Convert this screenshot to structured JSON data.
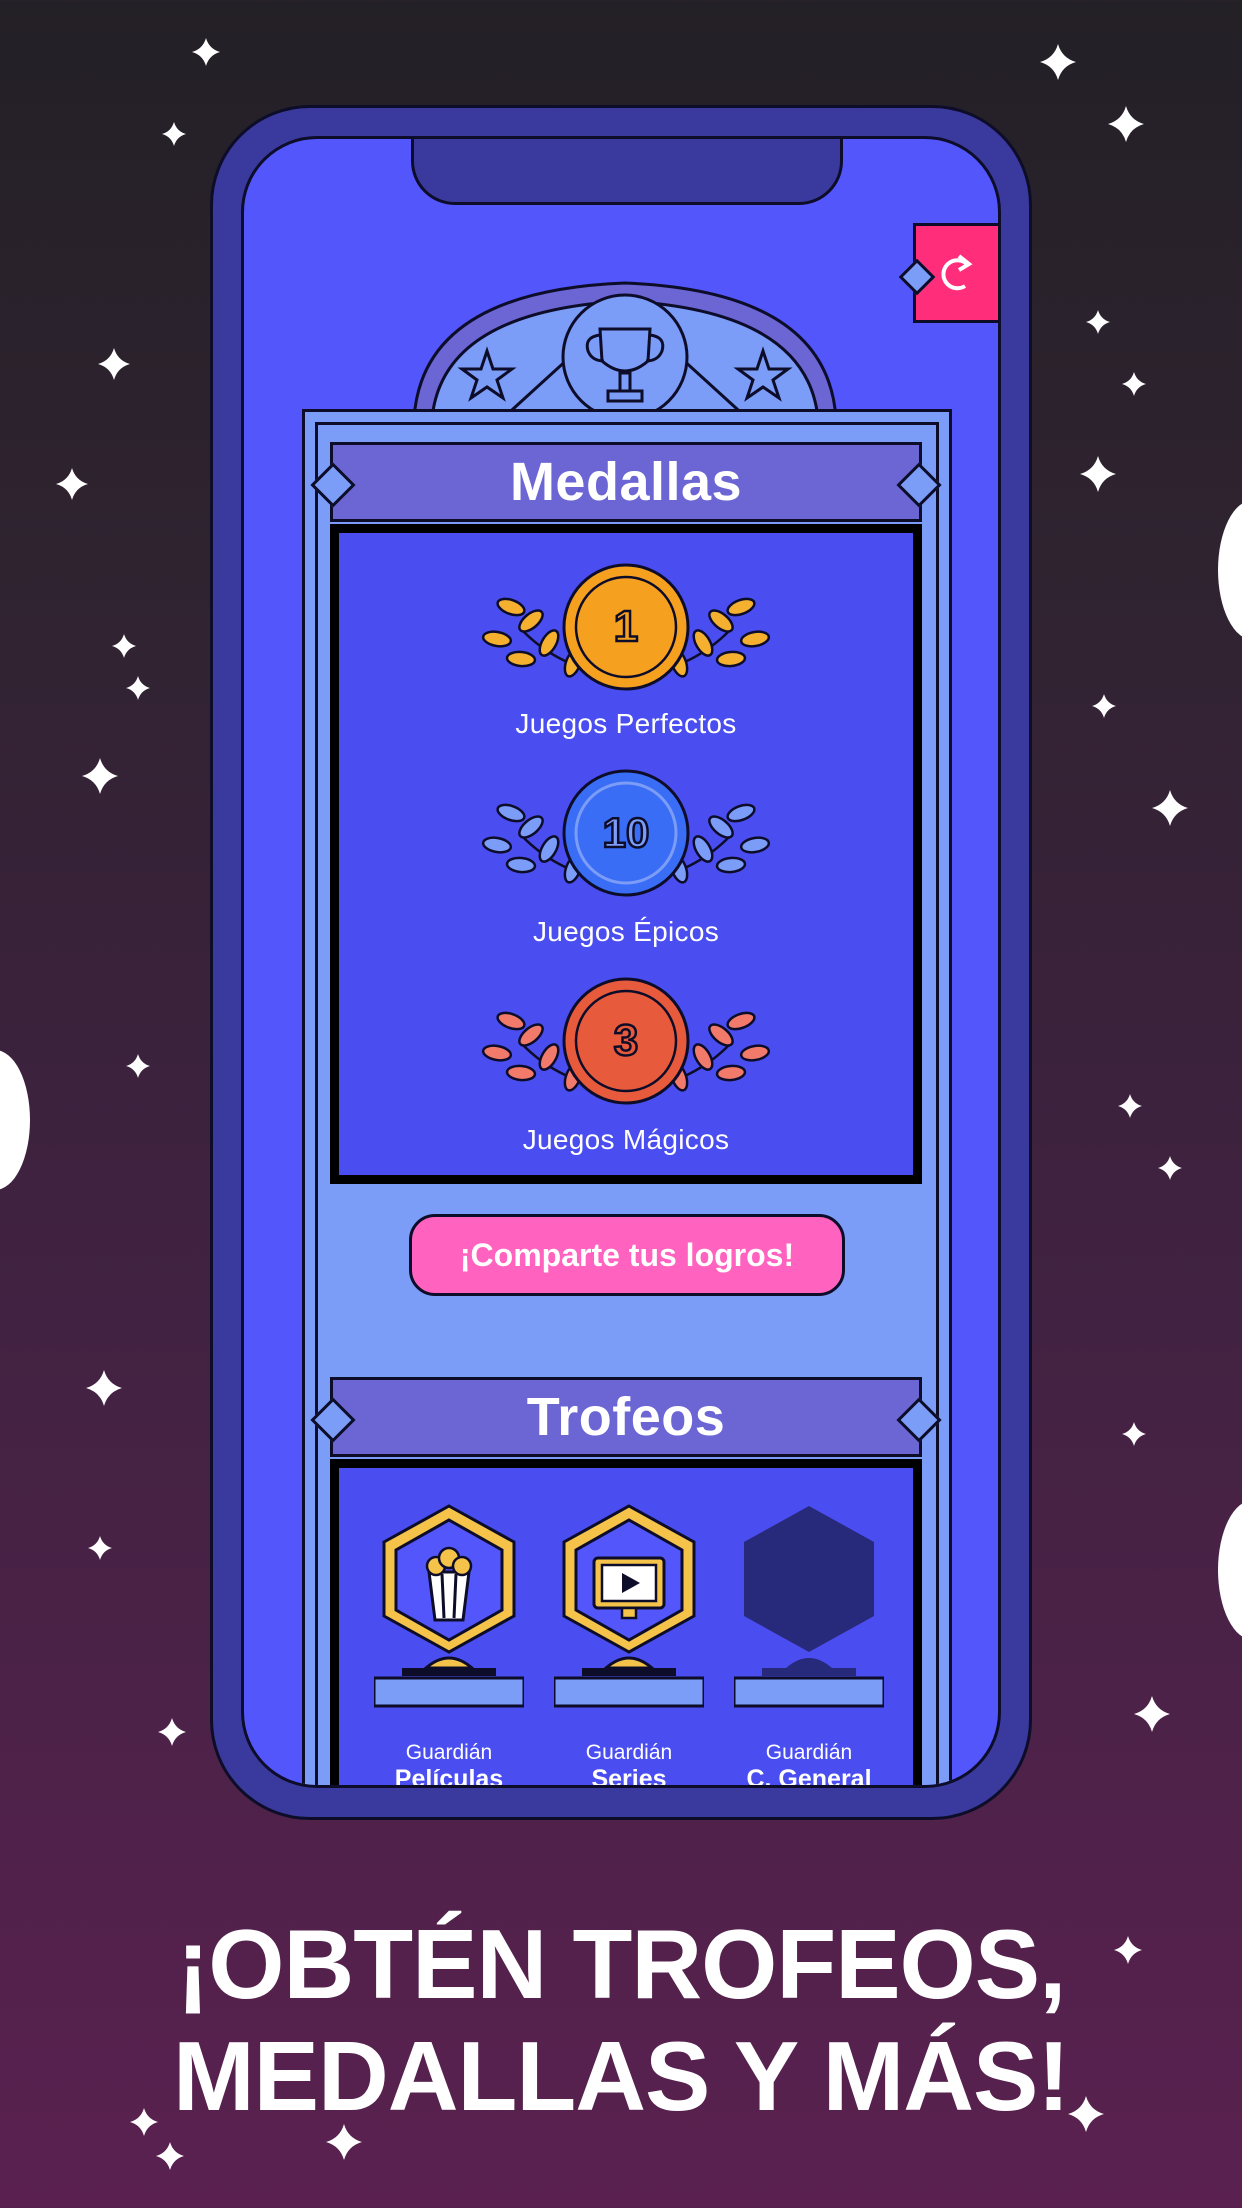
{
  "colors": {
    "accent_pink": "#ff2d7a",
    "share_button": "#ff62bf",
    "screen_blue": "#5256fb",
    "panel_light_blue": "#7b9cf7",
    "banner_purple": "#6b66d4",
    "medal_gold": "#f5a01f",
    "medal_blue": "#3a6df5",
    "medal_red": "#e85a3c",
    "trophy_gold": "#f5c34a",
    "trophy_locked": "#27297a"
  },
  "header": {
    "refresh_icon": "refresh-icon",
    "emblem_icon": "trophy-icon"
  },
  "medals": {
    "title": "Medallas",
    "items": [
      {
        "count": "1",
        "label": "Juegos Perfectos",
        "color": "gold"
      },
      {
        "count": "10",
        "label": "Juegos Épicos",
        "color": "blue"
      },
      {
        "count": "3",
        "label": "Juegos Mágicos",
        "color": "red"
      }
    ]
  },
  "share": {
    "label": "¡Comparte tus logros!"
  },
  "trophies": {
    "title": "Trofeos",
    "items": [
      {
        "subtitle": "Guardián",
        "name": "Películas",
        "icon": "popcorn-icon",
        "unlocked": true
      },
      {
        "subtitle": "Guardián",
        "name": "Series",
        "icon": "tv-play-icon",
        "unlocked": true
      },
      {
        "subtitle": "Guardián",
        "name": "C. General",
        "icon": "locked-hexagon-icon",
        "unlocked": false
      }
    ]
  },
  "promo": {
    "line1": "¡OBTÉN TROFEOS,",
    "line2": "MEDALLAS Y MÁS!"
  }
}
